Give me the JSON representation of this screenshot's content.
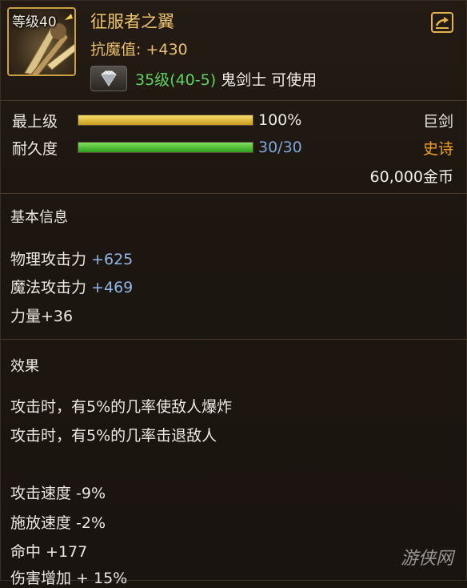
{
  "item": {
    "level_badge": "等级40",
    "name": "征服者之翼",
    "resist": "抗魔值: +430",
    "req_level": "35级(40-5)",
    "req_class": "鬼剑士 可使用"
  },
  "stats": {
    "grade_label": "最上级",
    "grade_value": "100%",
    "grade_fraction": 1.0,
    "durability_label": "耐久度",
    "durability_value": "30/30",
    "durability_fraction": 1.0
  },
  "meta": {
    "weapon_type": "巨剑",
    "rarity": "史诗",
    "price": "60,000金币"
  },
  "basic": {
    "heading": "基本信息",
    "phys_label": "物理攻击力",
    "phys_value": "+625",
    "magic_label": "魔法攻击力",
    "magic_value": "+469",
    "strength": "力量+36"
  },
  "effects": {
    "heading": "效果",
    "lines": [
      "攻击时，有5%的几率使敌人爆炸",
      "攻击时，有5%的几率击退敌人"
    ],
    "mods": [
      "攻击速度 -9%",
      "施放速度 -2%",
      "命中 +177",
      "伤害增加 + 15%"
    ]
  },
  "watermark": "游侠网",
  "colors": {
    "title": "#f0c46a",
    "rarity": "#f0a020",
    "durability_text": "#7aa6d8",
    "required_level": "#5fd35f"
  },
  "icons": {
    "item_icon": "wings-of-conqueror-icon",
    "gem": "diamond-icon",
    "share": "share-export-icon"
  }
}
